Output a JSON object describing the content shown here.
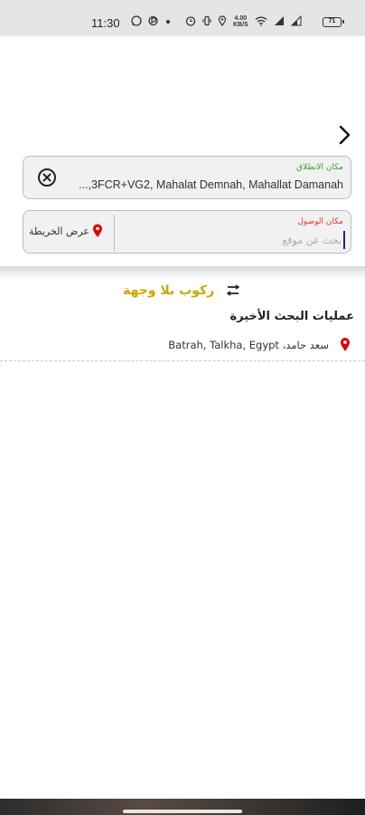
{
  "status_bar": {
    "time": "11:30",
    "speed_top": "4.00",
    "speed_bottom": "KB/S",
    "battery": "71"
  },
  "form": {
    "start_label": "مكان الانطلاق",
    "start_value": "3FCR+VG2, Mahalat Demnah, Mahallat Damanah,...",
    "dest_label": "مكان الوصول",
    "dest_placeholder": "بحث عن موقع",
    "map_link_label": "عرض الخريطة"
  },
  "no_destination": {
    "label": "ركوب بلا وجهة"
  },
  "recent": {
    "title": "عمليات البحث الأخيرة",
    "items": [
      {
        "label": "سعد حامد، Batrah, Talkha, Egypt"
      }
    ]
  },
  "colors": {
    "start_label": "#3d9b35",
    "dest_label": "#e53935",
    "no_destination": "#c9a800",
    "pin": "#e00000"
  }
}
